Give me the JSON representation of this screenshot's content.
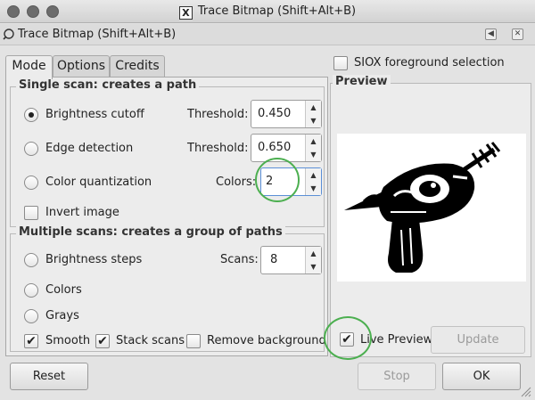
{
  "window": {
    "title": "Trace Bitmap (Shift+Alt+B)",
    "x_logo": "X"
  },
  "dock": {
    "title": "Trace Bitmap (Shift+Alt+B)"
  },
  "tabs": [
    {
      "label": "Mode"
    },
    {
      "label": "Options"
    },
    {
      "label": "Credits"
    }
  ],
  "single_scan": {
    "title": "Single scan: creates a path",
    "brightness": {
      "label": "Brightness cutoff",
      "field_label": "Threshold:",
      "value": "0.450"
    },
    "edge": {
      "label": "Edge detection",
      "field_label": "Threshold:",
      "value": "0.650"
    },
    "color": {
      "label": "Color quantization",
      "field_label": "Colors:",
      "value": "2"
    },
    "invert": {
      "label": "Invert image"
    }
  },
  "multiple_scans": {
    "title": "Multiple scans: creates a group of paths",
    "brightness_steps": {
      "label": "Brightness steps",
      "field_label": "Scans:",
      "value": "8"
    },
    "colors": {
      "label": "Colors"
    },
    "grays": {
      "label": "Grays"
    },
    "smooth": {
      "label": "Smooth"
    },
    "stack": {
      "label": "Stack scans"
    },
    "remove_bg": {
      "label": "Remove background"
    }
  },
  "siox": {
    "label": "SIOX foreground selection"
  },
  "preview": {
    "title": "Preview",
    "live_label": "Live Preview",
    "update_label": "Update"
  },
  "buttons": {
    "reset": "Reset",
    "stop": "Stop",
    "ok": "OK"
  },
  "colors": {
    "annotation_circle": "#4caf50"
  }
}
